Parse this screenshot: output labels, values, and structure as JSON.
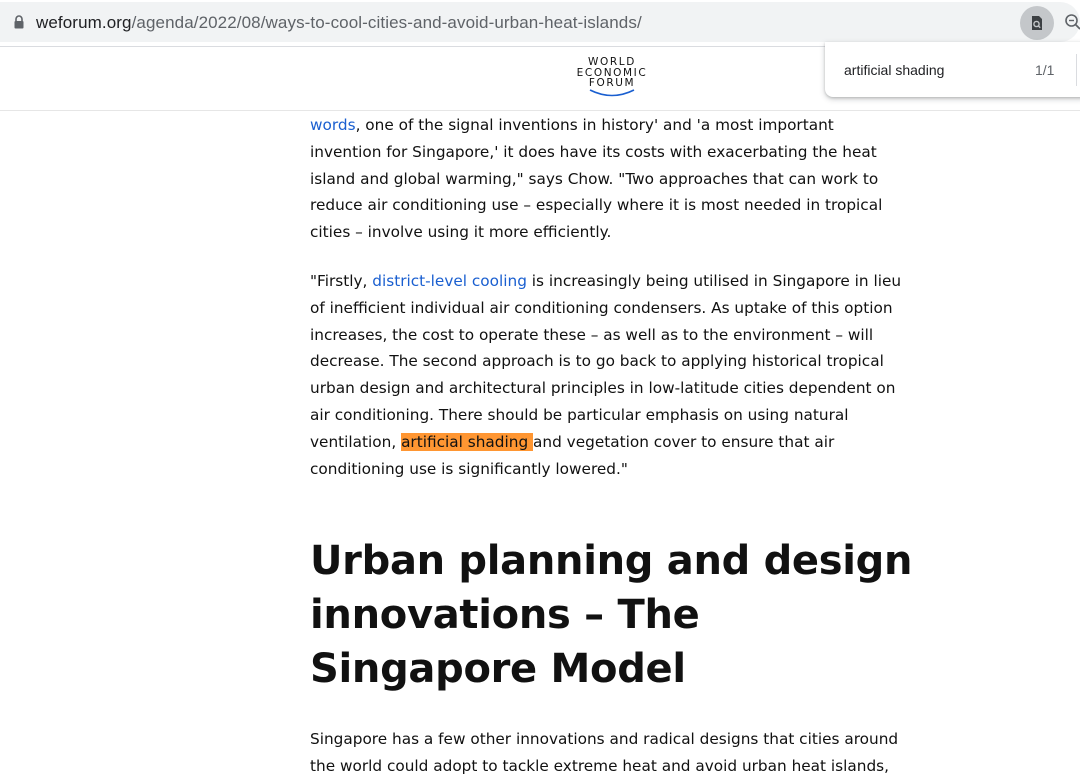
{
  "browser": {
    "url_host": "weforum.org",
    "url_path": "/agenda/2022/08/ways-to-cool-cities-and-avoid-urban-heat-islands/",
    "icons": [
      "lock-icon",
      "find-in-page-icon",
      "zoom-icon"
    ]
  },
  "site": {
    "logo_lines": [
      "WORLD",
      "ECONOMIC",
      "FORUM"
    ]
  },
  "find": {
    "query": "artificial shading",
    "count": "1/1"
  },
  "article": {
    "p1": {
      "l1_link": "words",
      "l1_rest": ", one of the signal inventions in history' and 'a most important",
      "l2": "invention for Singapore,' it does have its costs with exacerbating the heat",
      "l3": "island and global warming,\" says Chow. \"Two approaches that can work to",
      "l4": "reduce air conditioning use – especially where it is most needed in tropical",
      "l5": "cities – involve using it more efficiently."
    },
    "p2": {
      "l1_pre": "\"Firstly, ",
      "l1_link": "district-level cooling",
      "l1_rest": " is increasingly being utilised in Singapore in lieu",
      "l2": "of inefficient individual air conditioning condensers. As uptake of this option",
      "l3": "increases, the cost to operate these – as well as to the environment – will",
      "l4": "decrease. The second approach is to go back to applying historical tropical",
      "l5": "urban design and architectural principles in low-latitude cities dependent on",
      "l6": "air conditioning. There should be particular emphasis on using natural",
      "l7_pre": "ventilation, ",
      "l7_highlight": "artificial shading ",
      "l7_rest": "and vegetation cover to ensure that air",
      "l8": "conditioning use is significantly lowered.\""
    },
    "heading": {
      "l1": "Urban planning and design",
      "l2": "innovations – The",
      "l3": "Singapore Model"
    },
    "p3": {
      "l1": "Singapore has a few other innovations and radical designs that cities around",
      "l2": "the world could adopt to tackle extreme heat and avoid urban heat islands,"
    }
  },
  "colors": {
    "link": "#1a5fd0",
    "highlight": "#ff9632"
  }
}
